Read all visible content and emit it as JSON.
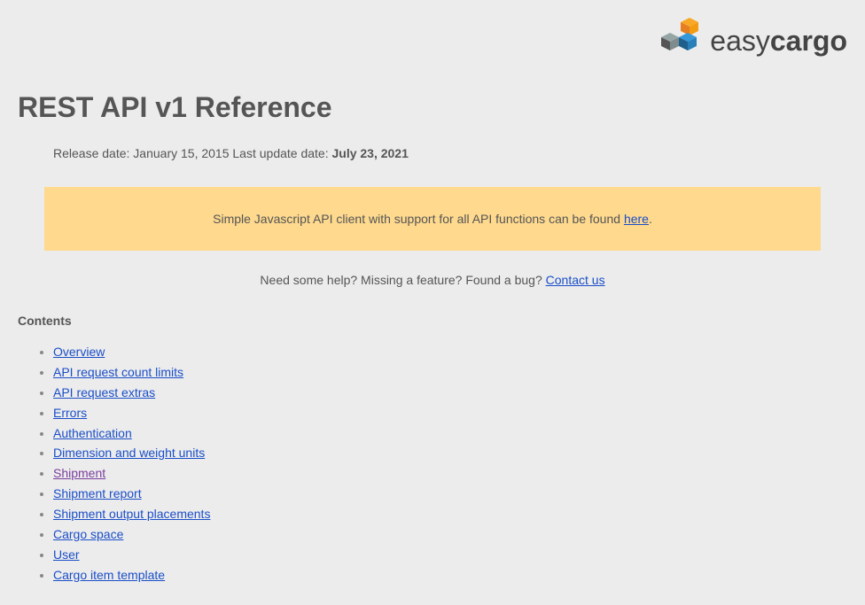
{
  "logo": {
    "text_normal": "easy",
    "text_bold": "cargo"
  },
  "title": "REST API v1 Reference",
  "release": {
    "prefix": "Release date: ",
    "release_date": "January 15, 2015",
    "update_prefix": " Last update date: ",
    "update_date": "July 23, 2021"
  },
  "notice": {
    "text": "Simple Javascript API client with support for all API functions can be found ",
    "link_text": "here",
    "suffix": "."
  },
  "help": {
    "text": "Need some help? Missing a feature? Found a bug? ",
    "link_text": "Contact us"
  },
  "contents": {
    "title": "Contents",
    "items": [
      {
        "label": "Overview",
        "visited": false
      },
      {
        "label": "API request count limits",
        "visited": false
      },
      {
        "label": "API request extras",
        "visited": false
      },
      {
        "label": "Errors",
        "visited": false
      },
      {
        "label": "Authentication",
        "visited": false
      },
      {
        "label": "Dimension and weight units",
        "visited": false
      },
      {
        "label": "Shipment",
        "visited": true
      },
      {
        "label": "Shipment report",
        "visited": false
      },
      {
        "label": "Shipment output placements",
        "visited": false
      },
      {
        "label": "Cargo space",
        "visited": false
      },
      {
        "label": "User",
        "visited": false
      },
      {
        "label": "Cargo item template",
        "visited": false
      }
    ]
  }
}
